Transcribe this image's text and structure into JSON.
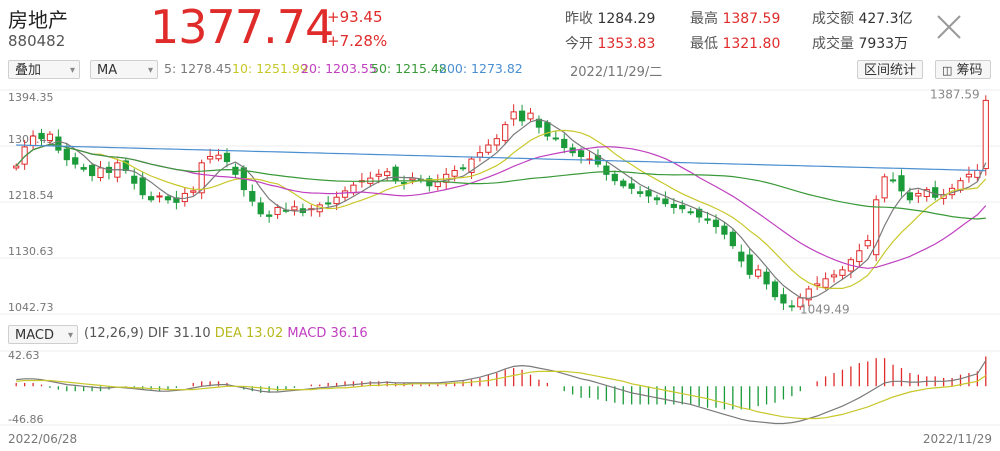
{
  "header": {
    "name": "房地产",
    "code": "880482",
    "price": "1377.74",
    "change": "+93.45",
    "change_pct": "+7.28%",
    "stats": [
      {
        "label": "昨收",
        "value": "1284.29",
        "color": "#333333"
      },
      {
        "label": "最高",
        "value": "1387.59",
        "color": "#e02b2b"
      },
      {
        "label": "成交额",
        "value": "427.3亿",
        "color": "#333333"
      },
      {
        "label": "今开",
        "value": "1353.83",
        "color": "#e02b2b"
      },
      {
        "label": "最低",
        "value": "1321.80",
        "color": "#e02b2b"
      },
      {
        "label": "成交量",
        "value": "7933万",
        "color": "#333333"
      }
    ],
    "close_icon": "close-icon"
  },
  "toolbar": {
    "overlay_label": "叠加",
    "ma_label": "MA",
    "ma_values": [
      {
        "label": "5:",
        "value": "1278.45",
        "color": "#7a7a7a"
      },
      {
        "label": "10:",
        "value": "1251.99",
        "color": "#c8c82a"
      },
      {
        "label": "20:",
        "value": "1203.55",
        "color": "#c040c0"
      },
      {
        "label": "50:",
        "value": "1215.48",
        "color": "#3a9a3a"
      },
      {
        "label": "200:",
        "value": "1273.82",
        "color": "#4a8fd0"
      }
    ],
    "date": "2022/11/29/二",
    "range_stats": "区间统计",
    "chips": "筹码"
  },
  "macd_bar": {
    "label": "MACD",
    "params": "(12,26,9)",
    "dif_label": "DIF",
    "dif_value": "31.10",
    "dea_label": "DEA",
    "dea_value": "13.02",
    "macd_label": "MACD",
    "macd_value": "36.16",
    "dif_color": "#7a7a7a",
    "dea_color": "#c8c82a",
    "macd_color": "#c040c0"
  },
  "colors": {
    "up": "#e02b2b",
    "down": "#1a9a39",
    "ma5": "#7a7a7a",
    "ma10": "#c8c82a",
    "ma20": "#c040c0",
    "ma50": "#3a9a3a",
    "ma200": "#4a8fd0"
  },
  "chart_data": {
    "type": "candlestick",
    "x_start": "2022/06/28",
    "x_end": "2022/11/29",
    "price_ticks": [
      "1394.35",
      "1306.45",
      "1218.54",
      "1130.63",
      "1042.73"
    ],
    "price_range": [
      1042.73,
      1394.35
    ],
    "annotations": {
      "max": "1387.59",
      "min": "1049.49"
    },
    "macd_ticks": [
      "42.63",
      "-46.86"
    ],
    "macd_range": [
      -46.86,
      42.63
    ],
    "closes": [
      1275,
      1305,
      1322,
      1318,
      1325,
      1300,
      1285,
      1278,
      1270,
      1260,
      1272,
      1265,
      1280,
      1268,
      1248,
      1230,
      1222,
      1228,
      1222,
      1218,
      1232,
      1236,
      1280,
      1290,
      1292,
      1282,
      1262,
      1238,
      1220,
      1200,
      1196,
      1210,
      1205,
      1211,
      1202,
      1208,
      1214,
      1216,
      1226,
      1236,
      1245,
      1252,
      1256,
      1262,
      1266,
      1252,
      1248,
      1256,
      1252,
      1244,
      1250,
      1262,
      1268,
      1272,
      1286,
      1296,
      1308,
      1318,
      1340,
      1360,
      1346,
      1358,
      1336,
      1322,
      1318,
      1304,
      1296,
      1290,
      1286,
      1278,
      1262,
      1252,
      1244,
      1240,
      1232,
      1228,
      1222,
      1216,
      1210,
      1208,
      1202,
      1195,
      1190,
      1180,
      1168,
      1150,
      1126,
      1105,
      1112,
      1090,
      1070,
      1060,
      1055,
      1068,
      1082,
      1090,
      1098,
      1104,
      1112,
      1128,
      1142,
      1158,
      1222,
      1258,
      1252,
      1236,
      1222,
      1232,
      1238,
      1226,
      1230,
      1240,
      1252,
      1262,
      1268,
      1378
    ],
    "dif": [
      8,
      9,
      9,
      8,
      6,
      4,
      2,
      1,
      0,
      -1,
      -2,
      -2,
      -1,
      -2,
      -3,
      -4,
      -5,
      -6,
      -6,
      -5,
      -4,
      -2,
      0,
      1,
      2,
      2,
      0,
      -2,
      -4,
      -6,
      -7,
      -7,
      -6,
      -5,
      -4,
      -3,
      -2,
      -1,
      0,
      1,
      2,
      3,
      4,
      4,
      5,
      4,
      4,
      4,
      4,
      4,
      4,
      5,
      6,
      7,
      9,
      11,
      14,
      17,
      21,
      24,
      25,
      24,
      22,
      20,
      18,
      15,
      12,
      9,
      7,
      4,
      1,
      -2,
      -5,
      -8,
      -10,
      -12,
      -14,
      -16,
      -18,
      -20,
      -22,
      -25,
      -28,
      -31,
      -34,
      -37,
      -40,
      -42,
      -43,
      -44,
      -45,
      -45,
      -44,
      -42,
      -39,
      -36,
      -32,
      -28,
      -24,
      -19,
      -14,
      -8,
      -2,
      4,
      6,
      6,
      5,
      5,
      6,
      6,
      6,
      7,
      9,
      12,
      15,
      31
    ],
    "dea": [
      6,
      7,
      7,
      7,
      7,
      6,
      5,
      4,
      3,
      2,
      1,
      0,
      -1,
      -1,
      -2,
      -2,
      -3,
      -3,
      -4,
      -4,
      -4,
      -4,
      -3,
      -2,
      -1,
      0,
      0,
      0,
      -1,
      -2,
      -3,
      -4,
      -4,
      -4,
      -4,
      -4,
      -3,
      -3,
      -2,
      -2,
      -1,
      0,
      1,
      1,
      2,
      2,
      2,
      3,
      3,
      3,
      3,
      3,
      4,
      4,
      5,
      6,
      7,
      9,
      11,
      13,
      15,
      17,
      18,
      18,
      18,
      18,
      17,
      16,
      14,
      12,
      10,
      8,
      6,
      3,
      1,
      -1,
      -3,
      -5,
      -7,
      -9,
      -11,
      -13,
      -15,
      -18,
      -20,
      -23,
      -26,
      -28,
      -31,
      -33,
      -35,
      -37,
      -38,
      -39,
      -39,
      -39,
      -38,
      -36,
      -34,
      -31,
      -28,
      -25,
      -21,
      -17,
      -13,
      -10,
      -7,
      -5,
      -3,
      -2,
      -1,
      0,
      2,
      4,
      6,
      13
    ],
    "macd": [
      4,
      4,
      4,
      2,
      -2,
      -4,
      -6,
      -6,
      -6,
      -6,
      -6,
      -4,
      0,
      -2,
      -2,
      -4,
      -4,
      -6,
      -4,
      -2,
      0,
      4,
      6,
      6,
      6,
      4,
      0,
      -4,
      -6,
      -8,
      -8,
      -6,
      -4,
      -2,
      0,
      2,
      2,
      4,
      4,
      6,
      6,
      6,
      6,
      6,
      6,
      4,
      4,
      2,
      2,
      2,
      2,
      4,
      4,
      6,
      8,
      10,
      14,
      16,
      20,
      22,
      20,
      14,
      8,
      4,
      0,
      -6,
      -10,
      -14,
      -14,
      -16,
      -18,
      -20,
      -22,
      -22,
      -22,
      -22,
      -22,
      -22,
      -22,
      -22,
      -22,
      -24,
      -26,
      -26,
      -28,
      -28,
      -28,
      -28,
      -24,
      -22,
      -20,
      -16,
      -12,
      -6,
      0,
      6,
      12,
      16,
      20,
      24,
      28,
      30,
      34,
      34,
      26,
      22,
      16,
      14,
      12,
      12,
      10,
      10,
      14,
      16,
      18,
      36
    ]
  }
}
